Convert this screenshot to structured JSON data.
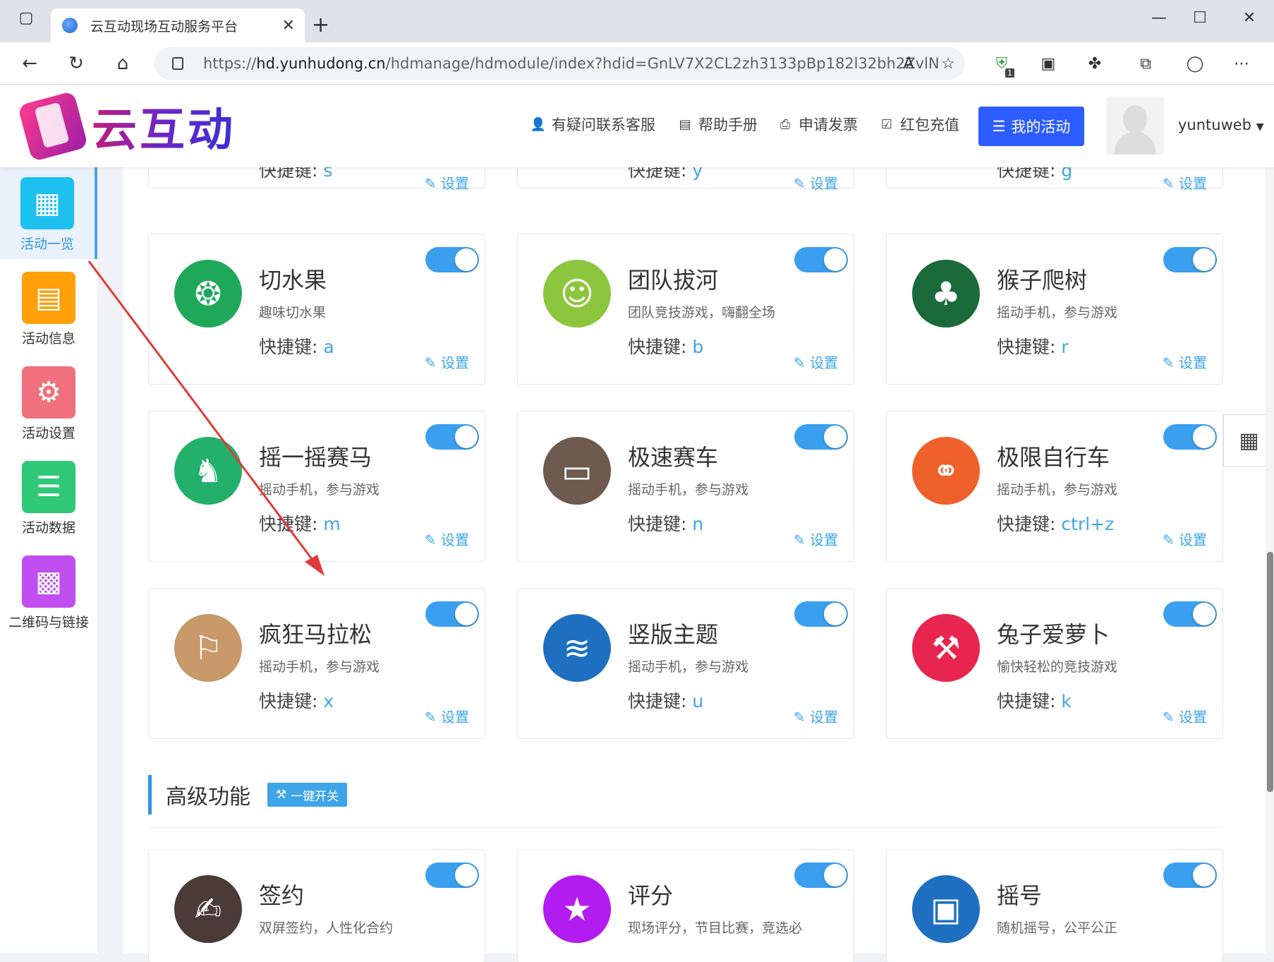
{
  "browser": {
    "tab_title": "云互动现场互动服务平台",
    "url_prefix": "https://",
    "url_host": "hd.yunhudong.cn",
    "url_path": "/hdmanage/hdmodule/index?hdid=GnLV7X2CL2zh3133pBp182l32bh2ZvlN",
    "ext_badge": "1"
  },
  "header": {
    "brand": "云互动",
    "menu": [
      {
        "label": "有疑问联系客服",
        "icon": "user-plus-icon"
      },
      {
        "label": "帮助手册",
        "icon": "book-icon"
      },
      {
        "label": "申请发票",
        "icon": "printer-icon"
      },
      {
        "label": "红包充值",
        "icon": "check-square-icon"
      }
    ],
    "my_activity": "我的活动",
    "username": "yuntuweb"
  },
  "sidebar": {
    "items": [
      {
        "label": "活动一览",
        "icon": "grid-icon",
        "color": "#1ec0f0",
        "active": true
      },
      {
        "label": "活动信息",
        "icon": "document-icon",
        "color": "#ff9f0a",
        "active": false
      },
      {
        "label": "活动设置",
        "icon": "gear-icon",
        "color": "#f0707e",
        "active": false
      },
      {
        "label": "活动数据",
        "icon": "database-icon",
        "color": "#2ec876",
        "active": false
      },
      {
        "label": "二维码与链接",
        "icon": "qrcode-icon",
        "color": "#c04ef0",
        "active": false
      }
    ]
  },
  "partial_row": [
    {
      "key": "s",
      "set": "设置"
    },
    {
      "key": "y",
      "set": "设置"
    },
    {
      "key": "g",
      "set": "设置"
    }
  ],
  "cards": [
    {
      "title": "切水果",
      "desc": "趣味切水果",
      "key_label": "快捷键:",
      "key": "a",
      "set": "设置",
      "color": "#1fa85a",
      "icon": "fruit-icon",
      "enabled": true
    },
    {
      "title": "团队拔河",
      "desc": "团队竞技游戏，嗨翻全场",
      "key_label": "快捷键:",
      "key": "b",
      "set": "设置",
      "color": "#8cc63e",
      "icon": "tug-of-war-icon",
      "enabled": true
    },
    {
      "title": "猴子爬树",
      "desc": "摇动手机，参与游戏",
      "key_label": "快捷键:",
      "key": "r",
      "set": "设置",
      "color": "#1b6b3a",
      "icon": "palm-tree-icon",
      "enabled": true
    },
    {
      "title": "摇一摇赛马",
      "desc": "摇动手机，参与游戏",
      "key_label": "快捷键:",
      "key": "m",
      "set": "设置",
      "color": "#23b06a",
      "icon": "horse-icon",
      "enabled": true
    },
    {
      "title": "极速赛车",
      "desc": "摇动手机，参与游戏",
      "key_label": "快捷键:",
      "key": "n",
      "set": "设置",
      "color": "#6e5a4e",
      "icon": "car-icon",
      "enabled": true
    },
    {
      "title": "极限自行车",
      "desc": "摇动手机，参与游戏",
      "key_label": "快捷键:",
      "key": "ctrl+z",
      "set": "设置",
      "color": "#f0602a",
      "icon": "bicycle-icon",
      "enabled": true
    },
    {
      "title": "疯狂马拉松",
      "desc": "摇动手机，参与游戏",
      "key_label": "快捷键:",
      "key": "x",
      "set": "设置",
      "color": "#c9996a",
      "icon": "runner-icon",
      "enabled": true
    },
    {
      "title": "竖版主题",
      "desc": "摇动手机，参与游戏",
      "key_label": "快捷键:",
      "key": "u",
      "set": "设置",
      "color": "#1e6fc0",
      "icon": "swimmer-icon",
      "enabled": true
    },
    {
      "title": "兔子爱萝卜",
      "desc": "愉快轻松的竞技游戏",
      "key_label": "快捷键:",
      "key": "k",
      "set": "设置",
      "color": "#e8254e",
      "icon": "hammer-icon",
      "enabled": true
    }
  ],
  "advanced": {
    "title": "高级功能",
    "toggle_all": "一键开关",
    "cards": [
      {
        "title": "签约",
        "desc": "双屏签约，人性化合约",
        "color": "#4a3b36",
        "icon": "signature-icon",
        "enabled": true
      },
      {
        "title": "评分",
        "desc": "现场评分，节目比赛，竞选必",
        "color": "#b31cf0",
        "icon": "star-icon",
        "enabled": true
      },
      {
        "title": "摇号",
        "desc": "随机摇号，公平公正",
        "color": "#1e6fc0",
        "icon": "lottery-icon",
        "enabled": true
      }
    ]
  }
}
